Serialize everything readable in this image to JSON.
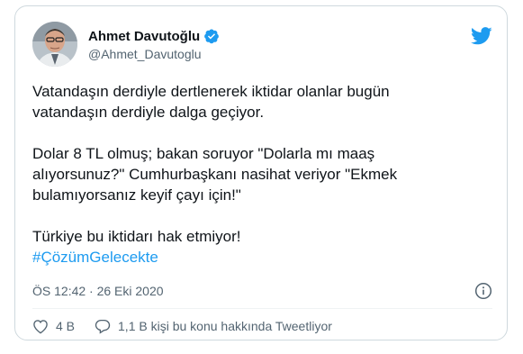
{
  "author": {
    "display_name": "Ahmet Davutoğlu",
    "handle": "@Ahmet_Davutoglu",
    "verified": true,
    "avatar_icon": "person-avatar"
  },
  "tweet": {
    "paragraphs": [
      "Vatandaşın derdiyle dertlenerek iktidar olanlar bugün\nvatandaşın derdiyle dalga geçiyor.",
      "Dolar 8 TL olmuş; bakan soruyor \"Dolarla mı maaş\nalıyorsunuz?\" Cumhurbaşkanı nasihat veriyor \"Ekmek\nbulamıyorsanız keyif çayı için!\"",
      "Türkiye bu iktidarı hak etmiyor!"
    ],
    "hashtag": "#ÇözümGelecekte"
  },
  "meta": {
    "timestamp": "ÖS 12:42 · 26 Eki 2020"
  },
  "actions": {
    "likes": "4 B",
    "replies": "1,1 B kişi bu konu hakkında Tweetliyor"
  },
  "colors": {
    "twitter_blue": "#1d9bf0",
    "secondary_text": "#536471",
    "card_border": "#cfd9de"
  },
  "icons": {
    "brand": "twitter-bird-icon",
    "verified": "verified-badge-icon",
    "info": "info-icon",
    "like": "heart-icon",
    "reply": "comment-bubble-icon"
  }
}
